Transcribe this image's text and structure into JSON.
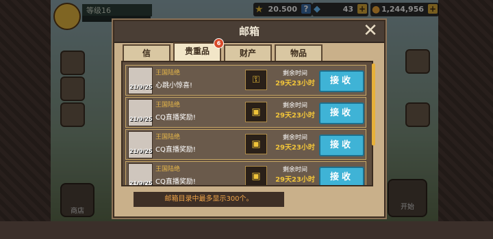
{
  "player": {
    "level_label": "等级16"
  },
  "hud": {
    "stars": "20.500",
    "gems": "43",
    "coins": "1,244,956",
    "plus": "+",
    "help": "?"
  },
  "dialog": {
    "title": "邮箱",
    "close": "✕",
    "tabs": [
      {
        "label": "信"
      },
      {
        "label": "贵重品",
        "badge": "6"
      },
      {
        "label": "财产"
      },
      {
        "label": "物品"
      }
    ],
    "footer": "邮箱目录中最多显示300个。"
  },
  "mails": [
    {
      "sender": "王国陆绝",
      "date": "21/9/25",
      "subject": "心跳小惊喜!",
      "time_label": "剩余时间",
      "time_value": "29天23小时",
      "claim": "接收",
      "gift_icon": "gold-key-icon"
    },
    {
      "sender": "王国陆绝",
      "date": "21/9/25",
      "subject": "CQ直播奖励!",
      "time_label": "剩余时间",
      "time_value": "29天23小时",
      "claim": "接收",
      "gift_icon": "chest-card-icon"
    },
    {
      "sender": "王国陆绝",
      "date": "21/9/25",
      "subject": "CQ直播奖励!",
      "time_label": "剩余时间",
      "time_value": "29天23小时",
      "claim": "接收",
      "gift_icon": "chest-card-icon"
    },
    {
      "sender": "王国陆绝",
      "date": "21/9/25",
      "subject": "CQ直播奖励!",
      "time_label": "剩余时间",
      "time_value": "29天23小时",
      "claim": "接收",
      "gift_icon": "chest-card-icon"
    }
  ],
  "bottom": {
    "shop": "商店",
    "start": "开始"
  },
  "colors": {
    "accent": "#3fb3d6",
    "gold": "#f0c43a",
    "panel": "#c9b08a"
  }
}
